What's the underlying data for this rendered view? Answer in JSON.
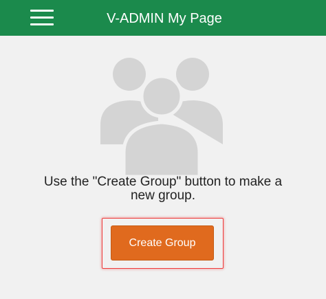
{
  "header": {
    "title": "V-ADMIN My Page",
    "menu_icon": "hamburger-menu-icon",
    "background_color": "#1b8a4c"
  },
  "empty_state": {
    "icon": "group-users-icon",
    "message": "Use the \"Create Group\" button to make a new group."
  },
  "actions": {
    "create_group_label": "Create Group",
    "button_color": "#e06a1e",
    "highlight_color": "#ee3a3a"
  }
}
